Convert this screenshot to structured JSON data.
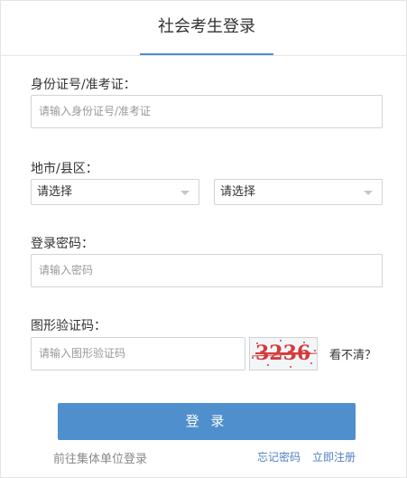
{
  "header": {
    "title": "社会考生登录"
  },
  "id_field": {
    "label": "身份证号/准考证：",
    "placeholder": "请输入身份证号/准考证"
  },
  "region": {
    "label": "地市/县区：",
    "city_select": "请选择",
    "district_select": "请选择"
  },
  "password_field": {
    "label": "登录密码：",
    "placeholder": "请输入密码"
  },
  "captcha": {
    "label": "图形验证码：",
    "placeholder": "请输入图形验证码",
    "image_text": "3236",
    "refresh_text": "看不清？"
  },
  "actions": {
    "login_button": "登 录",
    "org_login_link": "前往集体单位登录",
    "forgot_password_link": "忘记密码",
    "register_link": "立即注册"
  },
  "colors": {
    "accent": "#4f8fcd",
    "link_blue": "#4f7fbf",
    "captcha_red": "#d33b3b"
  }
}
